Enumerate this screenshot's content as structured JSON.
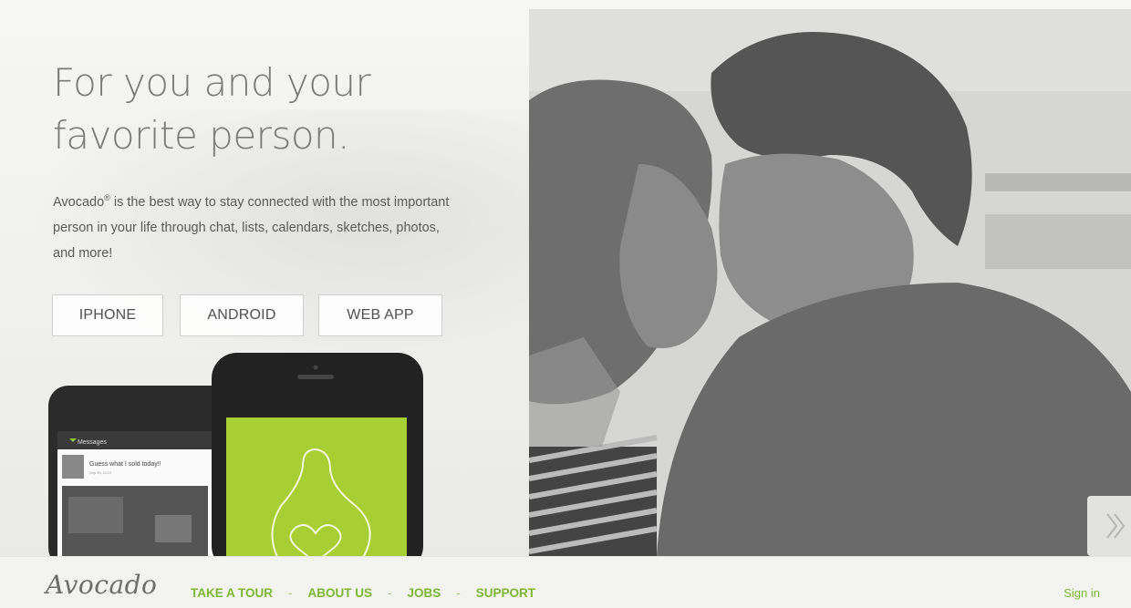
{
  "hero": {
    "headline_line1": "For you and your",
    "headline_line2": "favorite person.",
    "intro_brand": "Avocado",
    "intro_reg": "®",
    "intro_rest": " is the best way to stay connected with the most important person in your life through chat, lists, calendars, sketches, photos, and more!"
  },
  "buttons": {
    "iphone": "IPHONE",
    "android": "ANDROID",
    "webapp": "WEB APP"
  },
  "phone_screen": {
    "header": "Messages",
    "message": "Guess what I sold today!!",
    "date": "Sep 30, 2013"
  },
  "footer": {
    "logo": "Avocado",
    "nav": [
      "TAKE A TOUR",
      "ABOUT US",
      "JOBS",
      "SUPPORT"
    ],
    "separator": "-",
    "signin": "Sign in"
  },
  "colors": {
    "accent_green": "#7cb82f",
    "screen_green": "#a7cf33"
  }
}
